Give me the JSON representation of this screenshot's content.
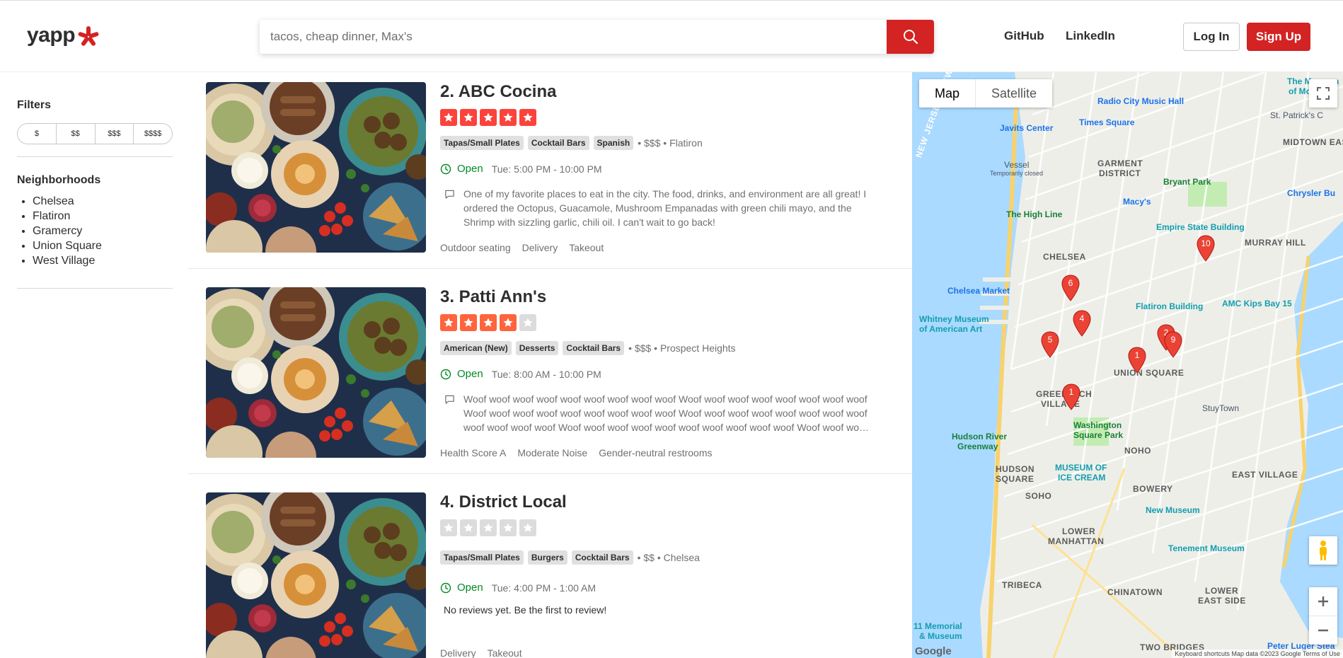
{
  "header": {
    "logo_text": "yapp",
    "search_placeholder": "tacos, cheap dinner, Max's",
    "nav_links": [
      "GitHub",
      "LinkedIn"
    ],
    "login_label": "Log In",
    "signup_label": "Sign Up",
    "brand_color": "#d32323"
  },
  "sidebar": {
    "filters_heading": "Filters",
    "price_options": [
      "$",
      "$$",
      "$$$",
      "$$$$"
    ],
    "neighborhoods_heading": "Neighborhoods",
    "neighborhoods": [
      "Chelsea",
      "Flatiron",
      "Gramercy",
      "Union Square",
      "West Village"
    ]
  },
  "results": [
    {
      "title": "2. ABC Cocina",
      "rating": 5,
      "tags": [
        "Tapas/Small Plates",
        "Cocktail Bars",
        "Spanish"
      ],
      "meta": "• $$$ • Flatiron",
      "status": "Open",
      "hours": "Tue: 5:00 PM - 10:00 PM",
      "review": "One of my favorite places to eat in the city. The food, drinks, and environment are all great! I ordered the Octopus, Guacamole, Mushroom Empanadas with green chili mayo, and the Shrimp with sizzling garlic, chili oil. I can't wait to go back!",
      "amenities": [
        "Outdoor seating",
        "Delivery",
        "Takeout"
      ]
    },
    {
      "title": "3. Patti Ann's",
      "rating": 4,
      "tags": [
        "American (New)",
        "Desserts",
        "Cocktail Bars"
      ],
      "meta": "• $$$ • Prospect Heights",
      "status": "Open",
      "hours": "Tue: 8:00 AM - 10:00 PM",
      "review": "Woof woof woof woof woof woof woof woof woof Woof woof woof woof woof woof woof woof Woof woof woof woof woof woof woof woof woof Woof woof woof woof woof woof woof woof woof woof woof woof Woof woof woof woof woof woof woof woof woof woof Woof woof woof woof woof woof woof",
      "amenities": [
        "Health Score A",
        "Moderate Noise",
        "Gender-neutral restrooms"
      ]
    },
    {
      "title": "4. District Local",
      "rating": 0,
      "tags": [
        "Tapas/Small Plates",
        "Burgers",
        "Cocktail Bars"
      ],
      "meta": "• $$ • Chelsea",
      "status": "Open",
      "hours": "Tue: 4:00 PM - 1:00 AM",
      "no_review": "No reviews yet. Be the first to review!",
      "amenities": [
        "Delivery",
        "Takeout"
      ]
    }
  ],
  "map": {
    "map_type_options": [
      "Map",
      "Satellite"
    ],
    "labels": {
      "garment": "GARMENT",
      "district": "DISTRICT",
      "midtown": "MIDTOWN EAS",
      "chelsea": "CHELSEA",
      "murray": "MURRAY HILL",
      "union": "UNION SQUARE",
      "greenwich": "GREENWICH",
      "village": "VILLAGE",
      "noho": "NOHO",
      "hudson": "HUDSON",
      "square": "SQUARE",
      "soho": "SOHO",
      "bowery": "BOWERY",
      "eastvillage": "EAST VILLAGE",
      "lower": "LOWER",
      "manhattan": "MANHATTAN",
      "tribeca": "TRIBECA",
      "chinatown": "CHINATOWN",
      "lowereast": "LOWER",
      "eastside": "EAST SIDE",
      "twobridges": "TWO BRIDGES",
      "njny": "NEW JERSEY / NEW YORK",
      "radiocity": "Radio City Music Hall",
      "javits": "Javits Center",
      "timessq": "Times Square",
      "vessel": "Vessel",
      "tempclosed": "Temporarily closed",
      "bryant": "Bryant Park",
      "macys": "Macy's",
      "chrysler": "Chrysler Bu",
      "highline": "The High Line",
      "esb": "Empire State Building",
      "chelseamkt": "Chelsea Market",
      "flatiron": "Flatiron Building",
      "amc": "AMC Kips Bay 15",
      "whitney": "Whitney Museum",
      "whitney2": "of American Art",
      "stuytown": "StuyTown",
      "washsq": "Washington",
      "washsq2": "Square Park",
      "hrg": "Hudson River",
      "hrg2": "Greenway",
      "iceCream": "MUSEUM OF",
      "iceCream2": "ICE CREAM",
      "newmuseum": "New Museum",
      "tenement": "Tenement Museum",
      "memorial": "11 Memorial",
      "memorial2": "& Museum",
      "moma": "The Museum",
      "moma2": "of Moder",
      "stpat": "St. Patrick's C",
      "peterluger": "Peter Luger Stea",
      "google": "Google",
      "attribution": "Keyboard shortcuts   Map data ©2023 Google   Terms of Use"
    },
    "pins": [
      "10",
      "6",
      "4",
      "5",
      "1",
      "2",
      "9",
      "1"
    ]
  }
}
